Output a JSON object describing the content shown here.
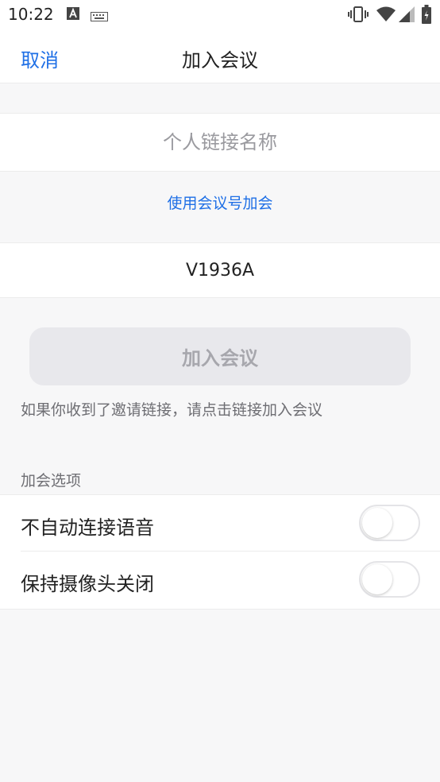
{
  "status_bar": {
    "time": "10:22"
  },
  "nav": {
    "cancel_label": "取消",
    "title": "加入会议"
  },
  "form": {
    "name_placeholder": "个人链接名称",
    "name_value": "",
    "use_meeting_id_link": "使用会议号加会",
    "meeting_id_value": "V1936A",
    "join_button_label": "加入会议",
    "join_button_enabled": false,
    "hint": "如果你收到了邀请链接，请点击链接加入会议"
  },
  "options": {
    "section_label": "加会选项",
    "items": [
      {
        "label": "不自动连接语音",
        "enabled": false
      },
      {
        "label": "保持摄像头关闭",
        "enabled": false
      }
    ]
  },
  "colors": {
    "accent": "#1e6fe6",
    "background": "#f7f7f8",
    "disabled_button_bg": "#e8e8ec",
    "disabled_button_text": "#a7a7ad"
  }
}
